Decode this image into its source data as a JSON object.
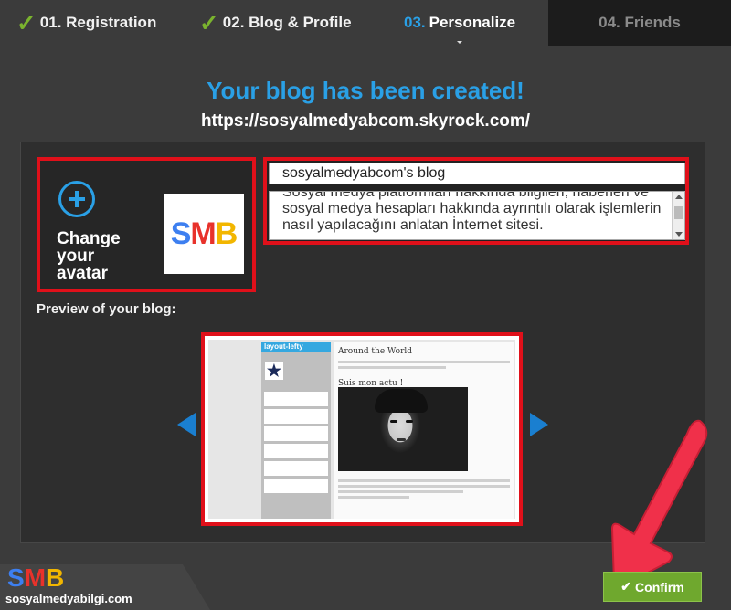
{
  "steps": [
    {
      "label": "01. Registration",
      "state": "done"
    },
    {
      "label": "02. Blog & Profile",
      "state": "done"
    },
    {
      "num": "03.",
      "label": "Personalize",
      "state": "active"
    },
    {
      "label": "04. Friends",
      "state": "inactive"
    }
  ],
  "header": {
    "title": "Your blog has been created!",
    "url": "https://sosyalmedyabcom.skyrock.com/"
  },
  "avatar": {
    "change_label": "Change your avatar",
    "image_text": {
      "s": "S",
      "m": "M",
      "b": "B"
    }
  },
  "blog": {
    "name_value": "sosyalmedyabcom's blog",
    "description_value": "Sosyal medya platformları hakkında bilgileri, haberleri ve sosyal medya hesapları hakkında ayrıntılı olarak işlemlerin nasıl yapılacağını anlatan İnternet sitesi."
  },
  "preview": {
    "label": "Preview of your blog:",
    "sidebar_title": "layout-lefty",
    "post_title_1": "Around the World",
    "post_title_2": "Suis mon actu !"
  },
  "confirm": {
    "label": "Confirm",
    "icon": "check-icon"
  },
  "watermark": {
    "logo": {
      "s": "S",
      "m": "M",
      "b": "B"
    },
    "site": "sosyalmedyabilgi.com"
  },
  "colors": {
    "accent_blue": "#2aa0e6",
    "highlight_red": "#e0101a",
    "confirm_green": "#6fa82e",
    "check_green": "#7ab32e"
  }
}
